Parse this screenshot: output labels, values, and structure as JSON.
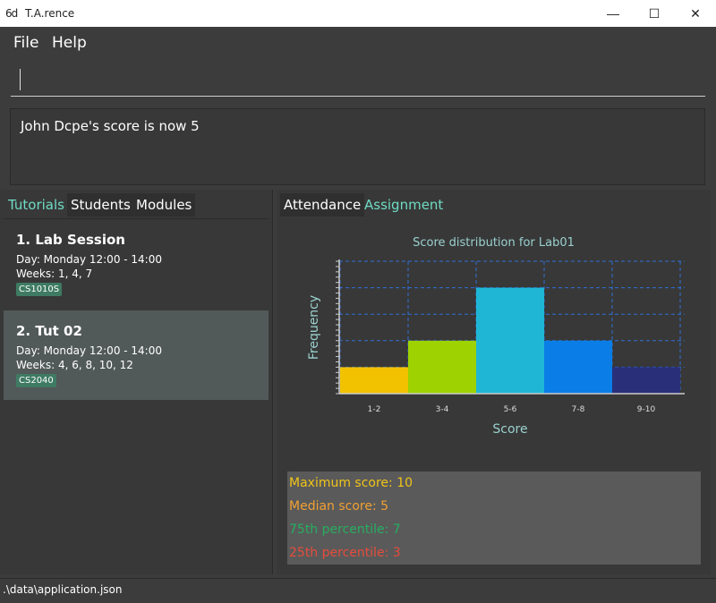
{
  "window": {
    "icon_glyph": "6d",
    "title": "T.A.rence",
    "controls": {
      "minimize": "—",
      "maximize": "☐",
      "close": "✕"
    }
  },
  "menu": {
    "file": "File",
    "help": "Help"
  },
  "command": {
    "value": ""
  },
  "result": {
    "message": "John Dcpe's score is now 5"
  },
  "left_tabs": [
    "Tutorials",
    "Students",
    "Modules"
  ],
  "tutorials": [
    {
      "title": "1.  Lab Session",
      "day": "Day: Monday 12:00 - 14:00",
      "weeks": "Weeks: 1, 4, 7",
      "module": "CS1010S",
      "selected": false
    },
    {
      "title": "2.  Tut 02",
      "day": "Day: Monday 12:00 - 14:00",
      "weeks": "Weeks: 4, 6, 8, 10, 12",
      "module": "CS2040",
      "selected": true
    }
  ],
  "right_tabs": {
    "attendance": "Attendance",
    "assignment": "Assignment"
  },
  "chart_data": {
    "type": "bar",
    "title": "Score distribution for Lab01",
    "xlabel": "Score",
    "ylabel": "Frequency",
    "categories": [
      "1-2",
      "3-4",
      "5-6",
      "7-8",
      "9-10"
    ],
    "values": [
      1,
      2,
      4,
      2,
      1
    ],
    "colors": [
      "#f2c200",
      "#9ed200",
      "#1fb6d6",
      "#0a7ee6",
      "#2a2f7a"
    ],
    "ylim": [
      0,
      5
    ],
    "grid": true
  },
  "stats": {
    "max": "Maximum score: 10",
    "median": "Median score: 5",
    "p75": "75th percentile: 7",
    "p25": "25th percentile: 3",
    "colors": {
      "max": "#f0c419",
      "median": "#f0a033",
      "p75": "#27ae60",
      "p25": "#e74c3c"
    }
  },
  "status": {
    "path": ".\\data\\application.json"
  }
}
